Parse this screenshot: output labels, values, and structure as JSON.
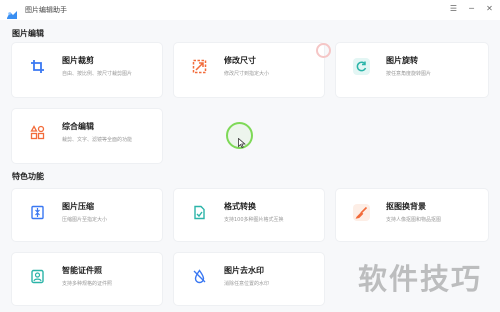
{
  "app": {
    "title": "图片编辑助手",
    "icon": "app-logo-icon"
  },
  "window_controls": [
    {
      "name": "menu-icon",
      "glyph": "☰"
    },
    {
      "name": "minimize-icon",
      "glyph": "─"
    },
    {
      "name": "close-icon",
      "glyph": "✕"
    }
  ],
  "sections": {
    "editing": "图片编辑",
    "features": "特色功能"
  },
  "cards": {
    "crop": {
      "title": "图片裁剪",
      "desc": "自由、按比例、按尺寸裁剪图片",
      "icon": "crop-icon",
      "color": "#3a78f2"
    },
    "resize": {
      "title": "修改尺寸",
      "desc": "修改尺寸到指定大小",
      "icon": "resize-icon",
      "color": "#f26b3a"
    },
    "rotate": {
      "title": "图片旋转",
      "desc": "按任意角度旋转图片",
      "icon": "rotate-icon",
      "color": "#2bb4a8"
    },
    "combo": {
      "title": "综合编辑",
      "desc": "裁剪、文字、滤镜等全面的功能",
      "icon": "grid-icon",
      "color": "#f26b3a"
    },
    "compress": {
      "title": "图片压缩",
      "desc": "压缩图片至指定大小",
      "icon": "compress-icon",
      "color": "#3a78f2"
    },
    "convert": {
      "title": "格式转换",
      "desc": "支持100多种图片格式互换",
      "icon": "convert-icon",
      "color": "#2bb4a8"
    },
    "cutout": {
      "title": "抠图换背景",
      "desc": "支持人像抠图和物品抠图",
      "icon": "brush-icon",
      "color": "#f26b3a"
    },
    "idphoto": {
      "title": "智能证件照",
      "desc": "支持多种规格的证件照",
      "icon": "id-photo-icon",
      "color": "#2bb4a8"
    },
    "watermark": {
      "title": "图片去水印",
      "desc": "消除任意位置的水印",
      "icon": "droplet-icon",
      "color": "#3a78f2"
    }
  },
  "overlay_watermark": "软件技巧"
}
